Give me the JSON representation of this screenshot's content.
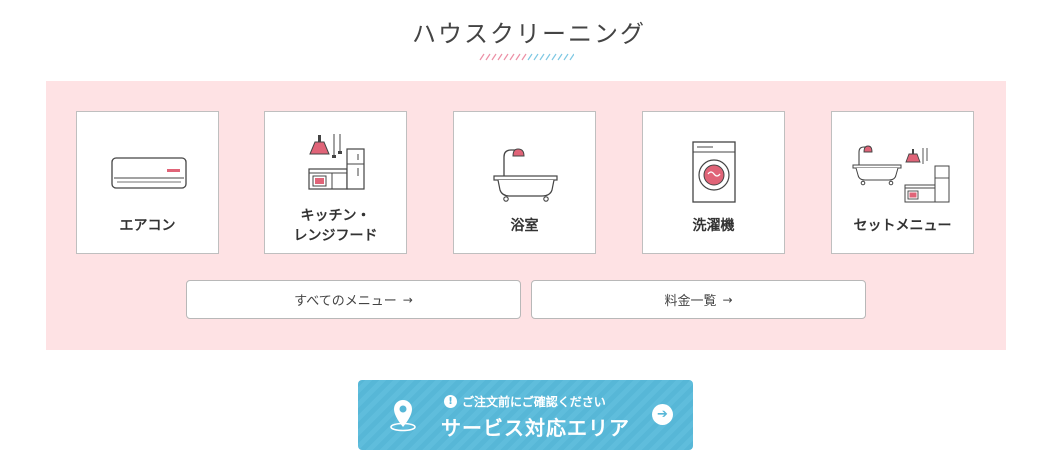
{
  "section": {
    "title": "ハウスクリーニング"
  },
  "cards": [
    {
      "label": "エアコン",
      "icon": "air-conditioner-icon"
    },
    {
      "label_line1": "キッチン・",
      "label_line2": "レンジフード",
      "icon": "kitchen-range-hood-icon"
    },
    {
      "label": "浴室",
      "icon": "bathtub-icon"
    },
    {
      "label": "洗濯機",
      "icon": "washing-machine-icon"
    },
    {
      "label": "セットメニュー",
      "icon": "set-menu-icon"
    }
  ],
  "buttons": {
    "all_menu": "すべてのメニュー",
    "price_list": "料金一覧",
    "arrow": "→"
  },
  "cta": {
    "note": "ご注文前にご確認ください",
    "note_icon": "!",
    "label": "サービス対応エリア",
    "go_arrow": "➔"
  },
  "colors": {
    "accent_pink": "#e06478",
    "panel_bg": "#fee2e4",
    "cta_blue": "#57b7d7"
  }
}
